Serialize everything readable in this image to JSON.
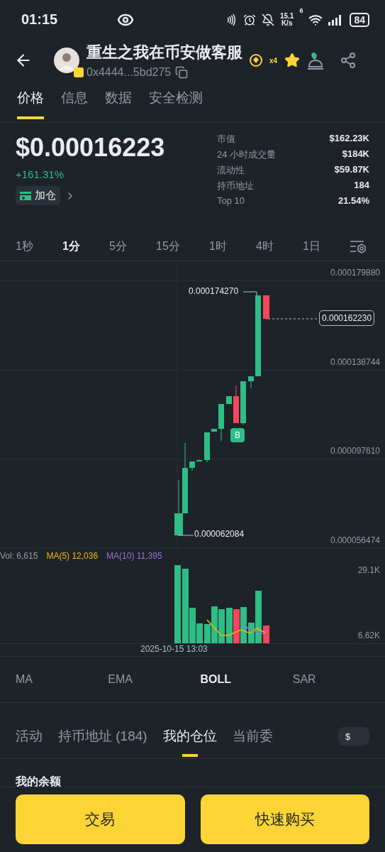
{
  "status_bar": {
    "time": "01:15",
    "speed_value": "15.1",
    "speed_unit": "K/s",
    "wifi_label": "6",
    "battery": "84"
  },
  "header": {
    "title": "重生之我在币安做客服",
    "address": "0x4444...5bd275",
    "level_badge": "x4"
  },
  "tabs": [
    {
      "label": "价格",
      "selected": true
    },
    {
      "label": "信息",
      "selected": false
    },
    {
      "label": "数据",
      "selected": false
    },
    {
      "label": "安全检测",
      "selected": false
    }
  ],
  "price": {
    "value": "$0.00016223",
    "change": "+161.31%",
    "add_button": "加仓"
  },
  "stats": [
    {
      "label": "市值",
      "value": "$162.23K"
    },
    {
      "label": "24 小时成交量",
      "value": "$184K"
    },
    {
      "label": "流动性",
      "value": "$59.87K"
    },
    {
      "label": "持币地址",
      "value": "184"
    },
    {
      "label": "Top 10",
      "value": "21.54%"
    }
  ],
  "intervals": [
    {
      "label": "1秒",
      "selected": false
    },
    {
      "label": "1分",
      "selected": true
    },
    {
      "label": "5分",
      "selected": false
    },
    {
      "label": "15分",
      "selected": false
    },
    {
      "label": "1时",
      "selected": false
    },
    {
      "label": "4时",
      "selected": false
    },
    {
      "label": "1日",
      "selected": false
    }
  ],
  "chart": {
    "y_ticks": [
      "0.000179880",
      "0.000138744",
      "0.000097610",
      "0.000056474"
    ],
    "high_label": "0.000174270",
    "low_label": "0.000062084",
    "last_price": "0.000162230",
    "marker": "B"
  },
  "volume": {
    "legend": [
      {
        "text": "Vol: 6,615",
        "color": "#929aa5"
      },
      {
        "text": "MA(5) 12,036",
        "color": "#f0b90b"
      },
      {
        "text": "MA(10) 11,395",
        "color": "#9c6fd6"
      }
    ],
    "ticks": [
      "29.1K",
      "6.62K"
    ],
    "date": "2025-10-15 13:03"
  },
  "indicators": [
    {
      "label": "MA",
      "selected": false
    },
    {
      "label": "EMA",
      "selected": false
    },
    {
      "label": "BOLL",
      "selected": true
    },
    {
      "label": "SAR",
      "selected": false
    }
  ],
  "position_tabs": [
    {
      "label": "活动",
      "selected": false
    },
    {
      "label": "持币地址 (184)",
      "selected": false
    },
    {
      "label": "我的仓位",
      "selected": true
    },
    {
      "label": "当前委",
      "selected": false
    }
  ],
  "currency_toggle": "$",
  "section_title": "我的余额",
  "actions": [
    "交易",
    "快速购买"
  ]
}
